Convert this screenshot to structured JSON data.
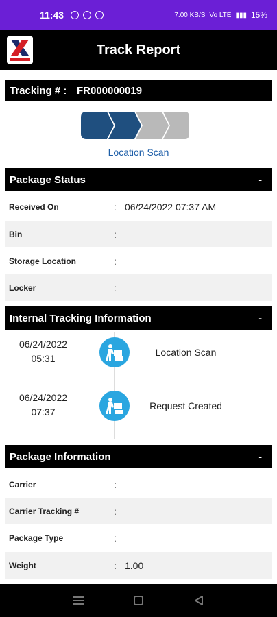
{
  "status_bar": {
    "time": "11:43",
    "battery": "15%",
    "network": "Vo LTE",
    "speed": "7.00 KB/S"
  },
  "header": {
    "title": "Track Report"
  },
  "tracking": {
    "label": "Tracking # :",
    "number": "FR000000019"
  },
  "progress": {
    "current_step": "Location Scan",
    "total_steps": 4,
    "completed_steps": 2,
    "colors": {
      "done": "#1f4f7f",
      "pending": "#b9b9b9"
    }
  },
  "package_status": {
    "title": "Package Status",
    "toggle": "-",
    "rows": [
      {
        "label": "Received On",
        "value": "06/24/2022 07:37 AM"
      },
      {
        "label": "Bin",
        "value": ""
      },
      {
        "label": "Storage Location",
        "value": ""
      },
      {
        "label": "Locker",
        "value": ""
      }
    ]
  },
  "internal_tracking": {
    "title": "Internal Tracking Information",
    "toggle": "-",
    "events": [
      {
        "date": "06/24/2022",
        "time": "05:31",
        "status": "Location Scan",
        "icon": "delivery-person-icon"
      },
      {
        "date": "06/24/2022",
        "time": "07:37",
        "status": "Request Created",
        "icon": "delivery-person-icon"
      }
    ]
  },
  "package_info": {
    "title": "Package Information",
    "toggle": "-",
    "rows": [
      {
        "label": "Carrier",
        "value": ""
      },
      {
        "label": "Carrier Tracking #",
        "value": ""
      },
      {
        "label": "Package Type",
        "value": ""
      },
      {
        "label": "Weight",
        "value": "1.00"
      }
    ]
  },
  "separator": ":",
  "colors": {
    "status_bar": "#6b1fd6",
    "accent": "#1d5ea8",
    "icon_bg": "#2aa6e0"
  }
}
